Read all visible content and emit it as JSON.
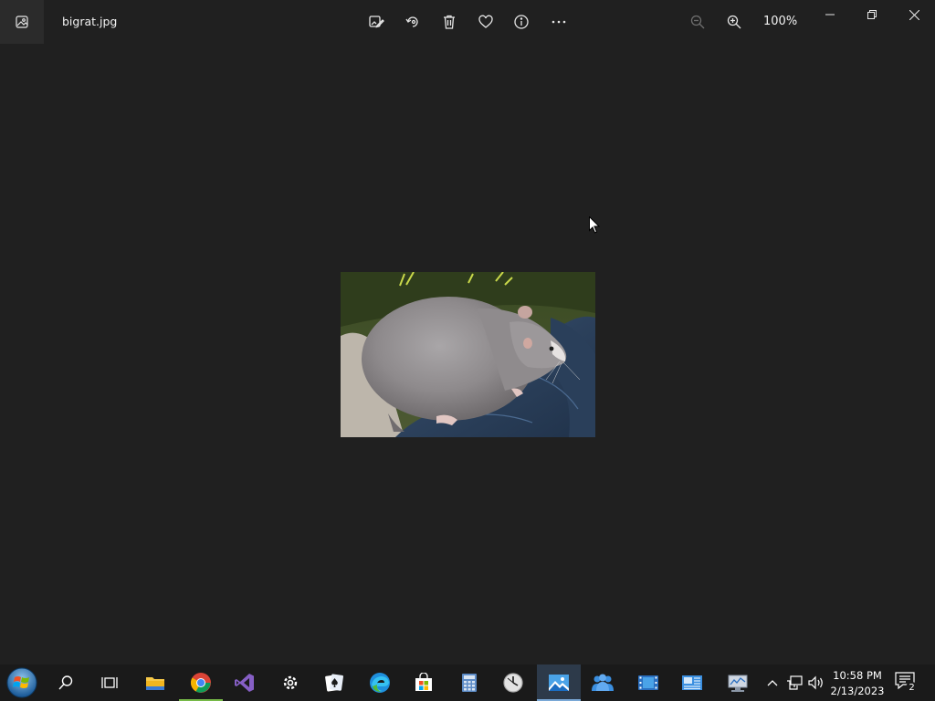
{
  "window": {
    "filename": "bigrat.jpg",
    "zoom": "100%"
  },
  "toolbar": {
    "items": [
      {
        "name": "edit-image-icon",
        "label": "Edit image"
      },
      {
        "name": "rotate-icon",
        "label": "Rotate"
      },
      {
        "name": "delete-icon",
        "label": "Delete"
      },
      {
        "name": "favorite-icon",
        "label": "Favorite"
      },
      {
        "name": "info-icon",
        "label": "File info"
      },
      {
        "name": "more-icon",
        "label": "See more"
      }
    ]
  },
  "taskbar": {
    "apps": [
      "start",
      "search",
      "task-view",
      "file-explorer",
      "chrome",
      "visual-studio",
      "settings",
      "solitaire",
      "edge",
      "store",
      "calculator",
      "clock",
      "photos",
      "people",
      "movies",
      "news",
      "network-monitor"
    ],
    "active_app": "photos"
  },
  "tray": {
    "time": "10:58 PM",
    "date": "2/13/2023",
    "notification_count": "2"
  },
  "colors": {
    "background": "#202020",
    "taskbar": "#1a1a1a",
    "accent": "#0078d7"
  }
}
